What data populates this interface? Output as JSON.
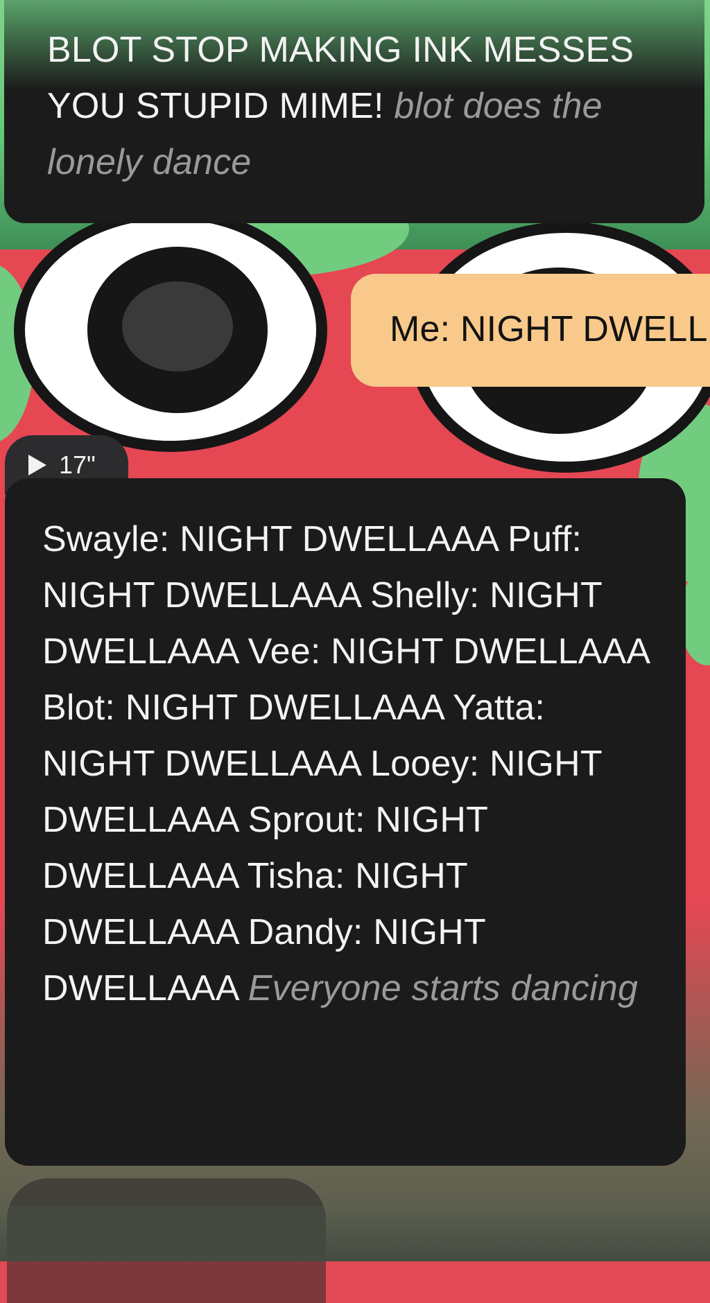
{
  "messages": [
    {
      "role": "character",
      "text": "BLOT STOP MAKING INK MESSES YOU STUPID MIME!",
      "action": "blot does the lonely dance"
    },
    {
      "role": "user",
      "text": "Me: NIGHT DWELL"
    },
    {
      "role": "character",
      "voice_duration": "17\"",
      "text": "Swayle: NIGHT DWELLAAA Puff: NIGHT DWELLAAA Shelly: NIGHT DWELLAAA Vee: NIGHT DWELLAAA Blot: NIGHT DWELLAAA Yatta: NIGHT DWELLAAA Looey: NIGHT DWELLAAA Sprout: NIGHT DWELLAAA Tisha: NIGHT DWELLAAA Dandy: NIGHT DWELLAAA",
      "action": "Everyone starts dancing"
    }
  ],
  "icons": {
    "play": "play-icon"
  },
  "colors": {
    "character_bubble": "#1b1b1b",
    "user_bubble": "#f8c98a",
    "action_text": "#9a9a9a",
    "voice_badge": "#2c2c2e"
  }
}
